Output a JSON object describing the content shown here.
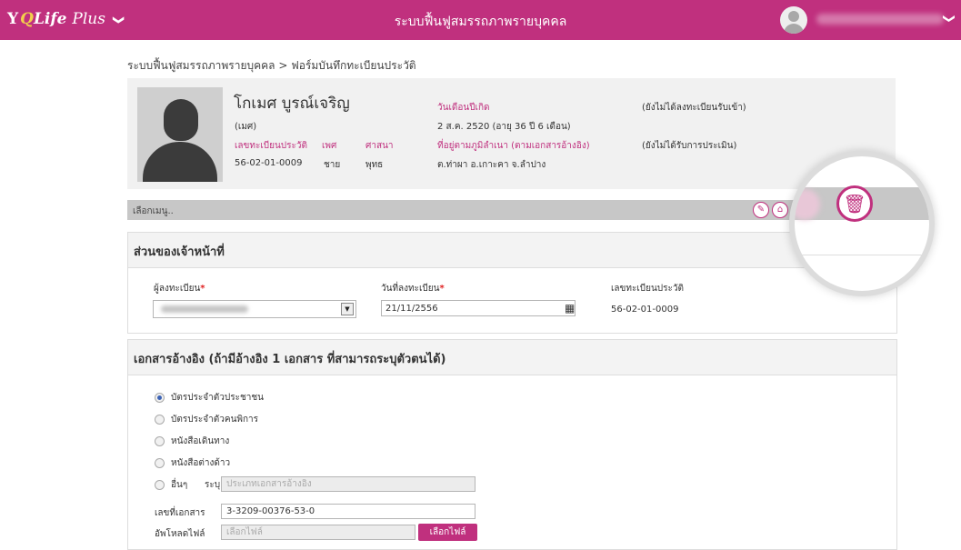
{
  "header": {
    "logo": {
      "icon": "yoga-figure-icon",
      "q": "Q",
      "life": "Life",
      "plus": "Plus",
      "chevron": "❯"
    },
    "title": "ระบบฟื้นฟูสมรรถภาพรายบุคคล",
    "user_chevron": "❯"
  },
  "breadcrumb": "ระบบฟื้นฟูสมรรถภาพรายบุคคล > ฟอร์มบันทึกทะเบียนประวัติ",
  "profile": {
    "name": "โกเมศ บูรณ์เจริญ",
    "nickname": "(เมศ)",
    "reg_no_label": "เลขทะเบียนประวัติ",
    "reg_no": "56-02-01-0009",
    "gender_label": "เพศ",
    "gender": "ชาย",
    "religion_label": "ศาสนา",
    "religion": "พุทธ",
    "birth_label": "วันเดือนปีเกิด",
    "birth_value": "2 ส.ค. 2520 (อายุ 36 ปี 6 เดือน)",
    "address_label": "ที่อยู่ตามภูมิลำเนา (ตามเอกสารอ้างอิง)",
    "address_value": "ต.ท่าผา อ.เกาะคา จ.ลำปาง",
    "status_admission": "(ยังไม่ได้ลงทะเบียนรับเข้า)",
    "status_assessment": "(ยังไม่ได้รับการประเมิน)"
  },
  "menubar": {
    "placeholder": "เลือกเมนู..",
    "icons": [
      "edit-icon",
      "home-icon",
      "delete-icon"
    ],
    "edit_glyph": "✎",
    "home_glyph": "⌂",
    "trash_glyph": "🗑"
  },
  "officer_section": {
    "title": "ส่วนของเจ้าหน้าที่",
    "registrar_label": "ผู้ลงทะเบียน",
    "register_date_label": "วันที่ลงทะเบียน",
    "register_date_value": "21/11/2556",
    "reg_no_label": "เลขทะเบียนประวัติ",
    "reg_no_value": "56-02-01-0009",
    "required_mark": "*",
    "select_arrow": "▼",
    "calendar_glyph": "▦"
  },
  "docs_section": {
    "title": "เอกสารอ้างอิง (ถ้ามีอ้างอิง 1 เอกสาร ที่สามารถระบุตัวตนได้)",
    "options": [
      "บัตรประจำตัวประชาชน",
      "บัตรประจำตัวคนพิการ",
      "หนังสือเดินทาง",
      "หนังสือต่างด้าว",
      "อื่นๆ"
    ],
    "selected": "บัตรประจำตัวประชาชน",
    "specify_label": "ระบุ",
    "specify_placeholder": "ประเภทเอกสารอ้างอิง",
    "doc_no_label": "เลขที่เอกสาร",
    "doc_no_value": "3-3209-00376-53-0",
    "upload_label": "อัพโหลดไฟล์",
    "upload_placeholder": "เลือกไฟล์",
    "choose_button": "เลือกไฟล์"
  },
  "colors": {
    "brand": "#c0307e",
    "menubar": "#c7c7c7",
    "panel_header": "#f3f3f3"
  }
}
